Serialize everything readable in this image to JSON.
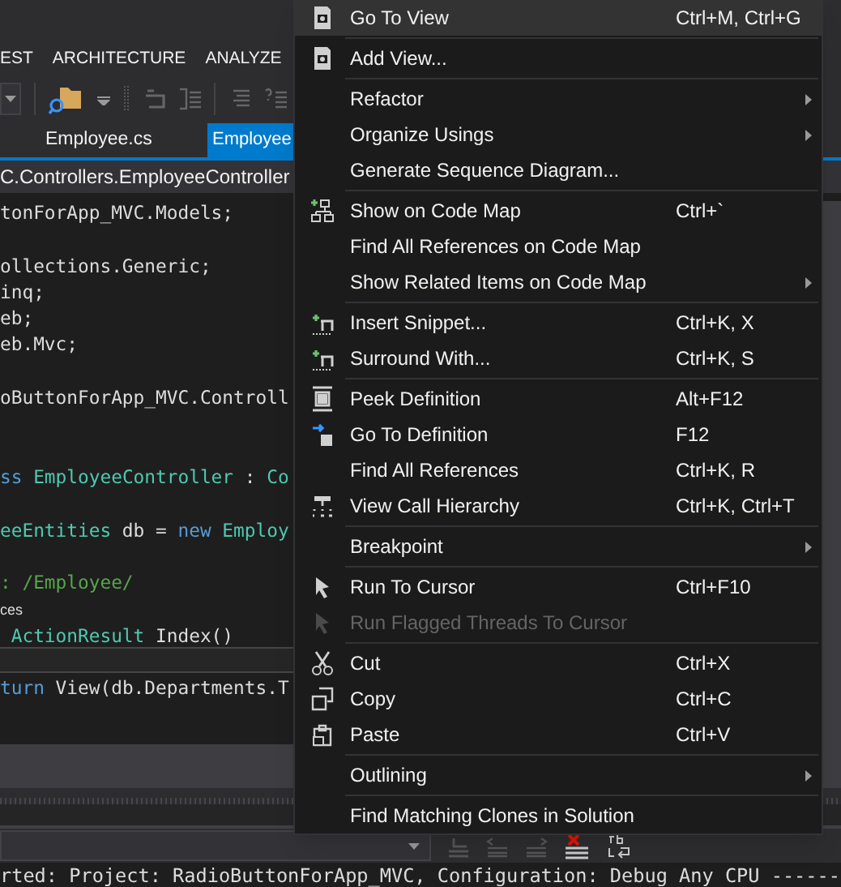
{
  "menu_bar": [
    {
      "label": "EST"
    },
    {
      "label": "ARCHITECTURE"
    },
    {
      "label": "ANALYZE"
    }
  ],
  "tabs": [
    {
      "label": "Employee.cs",
      "selected": false
    },
    {
      "label": "Employee",
      "selected": true
    }
  ],
  "navigation_bar": {
    "text": "C.Controllers.EmployeeController"
  },
  "editor": {
    "lines": [
      {
        "kind": "code",
        "current": false,
        "tokens": [
          {
            "kind": "plain",
            "text": "tonForApp_MVC.Models;"
          }
        ]
      },
      {
        "kind": "blank",
        "current": false
      },
      {
        "kind": "code",
        "current": false,
        "tokens": [
          {
            "kind": "plain",
            "text": "ollections.Generic;"
          }
        ]
      },
      {
        "kind": "code",
        "current": false,
        "tokens": [
          {
            "kind": "plain",
            "text": "inq;"
          }
        ]
      },
      {
        "kind": "code",
        "current": false,
        "tokens": [
          {
            "kind": "plain",
            "text": "eb;"
          }
        ]
      },
      {
        "kind": "code",
        "current": false,
        "tokens": [
          {
            "kind": "plain",
            "text": "eb.Mvc;"
          }
        ]
      },
      {
        "kind": "blank",
        "current": false
      },
      {
        "kind": "code",
        "current": false,
        "tokens": [
          {
            "kind": "plain",
            "text": "oButtonForApp_MVC.Controll"
          }
        ]
      },
      {
        "kind": "blank",
        "current": false
      },
      {
        "kind": "blank",
        "current": false
      },
      {
        "kind": "code",
        "current": false,
        "tokens": [
          {
            "kind": "keyword",
            "text": "ss"
          },
          {
            "kind": "type",
            "text": " EmployeeController"
          },
          {
            "kind": "plain",
            "text": " : "
          },
          {
            "kind": "type",
            "text": "Co"
          }
        ]
      },
      {
        "kind": "blank",
        "current": false
      },
      {
        "kind": "code",
        "current": false,
        "tokens": [
          {
            "kind": "type",
            "text": "eeEntities"
          },
          {
            "kind": "plain",
            "text": " db = "
          },
          {
            "kind": "keyword",
            "text": "new"
          },
          {
            "kind": "type",
            "text": " Employ"
          }
        ]
      },
      {
        "kind": "blank",
        "current": false
      },
      {
        "kind": "code",
        "current": false,
        "tokens": [
          {
            "kind": "comment",
            "text": ": /Employee/"
          }
        ]
      },
      {
        "kind": "lens",
        "current": false,
        "tokens": [
          {
            "kind": "plain",
            "text": "ces"
          }
        ]
      },
      {
        "kind": "code",
        "current": false,
        "tokens": [
          {
            "kind": "type",
            "text": " ActionResult"
          },
          {
            "kind": "plain",
            "text": " Index()"
          }
        ]
      },
      {
        "kind": "blank",
        "current": true
      },
      {
        "kind": "code",
        "current": false,
        "tokens": [
          {
            "kind": "keyword",
            "text": "turn"
          },
          {
            "kind": "plain",
            "text": " View(db.Departments.T"
          }
        ]
      }
    ]
  },
  "output_line": {
    "text": "rted: Project: RadioButtonForApp_MVC, Configuration: Debug Any CPU ------"
  },
  "context_menu": {
    "groups": [
      [
        {
          "label": "Go To View",
          "shortcut": "Ctrl+M, Ctrl+G",
          "selected": true,
          "disabled": false,
          "submenu": false
        }
      ],
      [
        {
          "label": "Add View...",
          "selected": false,
          "disabled": false,
          "submenu": false
        }
      ],
      [
        {
          "label": "Refactor",
          "selected": false,
          "disabled": false,
          "submenu": true
        },
        {
          "label": "Organize Usings",
          "selected": false,
          "disabled": false,
          "submenu": true
        },
        {
          "label": "Generate Sequence Diagram...",
          "selected": false,
          "disabled": false,
          "submenu": false
        }
      ],
      [
        {
          "label": "Show on Code Map",
          "shortcut": "Ctrl+`",
          "selected": false,
          "disabled": false,
          "submenu": false
        },
        {
          "label": "Find All References on Code Map",
          "selected": false,
          "disabled": false,
          "submenu": false
        },
        {
          "label": "Show Related Items on Code Map",
          "selected": false,
          "disabled": false,
          "submenu": true
        }
      ],
      [
        {
          "label": "Insert Snippet...",
          "shortcut": "Ctrl+K, X",
          "selected": false,
          "disabled": false,
          "submenu": false
        },
        {
          "label": "Surround With...",
          "shortcut": "Ctrl+K, S",
          "selected": false,
          "disabled": false,
          "submenu": false
        }
      ],
      [
        {
          "label": "Peek Definition",
          "shortcut": "Alt+F12",
          "selected": false,
          "disabled": false,
          "submenu": false
        },
        {
          "label": "Go To Definition",
          "shortcut": "F12",
          "selected": false,
          "disabled": false,
          "submenu": false
        },
        {
          "label": "Find All References",
          "shortcut": "Ctrl+K, R",
          "selected": false,
          "disabled": false,
          "submenu": false
        },
        {
          "label": "View Call Hierarchy",
          "shortcut": "Ctrl+K, Ctrl+T",
          "selected": false,
          "disabled": false,
          "submenu": false
        }
      ],
      [
        {
          "label": "Breakpoint",
          "selected": false,
          "disabled": false,
          "submenu": true
        }
      ],
      [
        {
          "label": "Run To Cursor",
          "shortcut": "Ctrl+F10",
          "selected": false,
          "disabled": false,
          "submenu": false
        },
        {
          "label": "Run Flagged Threads To Cursor",
          "selected": false,
          "disabled": true,
          "submenu": false
        }
      ],
      [
        {
          "label": "Cut",
          "shortcut": "Ctrl+X",
          "selected": false,
          "disabled": false,
          "submenu": false
        },
        {
          "label": "Copy",
          "shortcut": "Ctrl+C",
          "selected": false,
          "disabled": false,
          "submenu": false
        },
        {
          "label": "Paste",
          "shortcut": "Ctrl+V",
          "selected": false,
          "disabled": false,
          "submenu": false
        }
      ],
      [
        {
          "label": "Outlining",
          "selected": false,
          "disabled": false,
          "submenu": true
        }
      ],
      [
        {
          "label": "Find Matching Clones in Solution",
          "selected": false,
          "disabled": false,
          "submenu": false
        }
      ]
    ]
  }
}
